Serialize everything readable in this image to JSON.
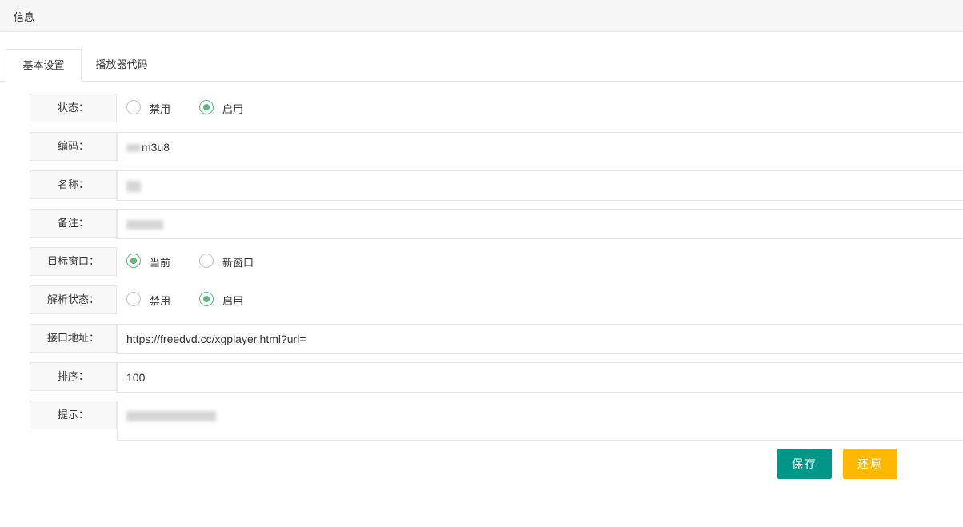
{
  "header": {
    "title": "信息"
  },
  "tabs": [
    {
      "label": "基本设置",
      "active": true
    },
    {
      "label": "播放器代码",
      "active": false
    }
  ],
  "form": {
    "status": {
      "label": "状态：",
      "options": [
        "禁用",
        "启用"
      ],
      "selected": "启用"
    },
    "code": {
      "label": "编码：",
      "value": "m3u8"
    },
    "name": {
      "label": "名称："
    },
    "remark": {
      "label": "备注："
    },
    "target": {
      "label": "目标窗口：",
      "options": [
        "当前",
        "新窗口"
      ],
      "selected": "当前"
    },
    "parse_status": {
      "label": "解析状态：",
      "options": [
        "禁用",
        "启用"
      ],
      "selected": "启用"
    },
    "api": {
      "label": "接口地址：",
      "value": "https://freedvd.cc/xgplayer.html?url="
    },
    "sort": {
      "label": "排序：",
      "value": "100"
    },
    "tip": {
      "label": "提示："
    }
  },
  "buttons": {
    "save": "保存",
    "reset": "还原"
  },
  "colors": {
    "primary": "#009688",
    "warm": "#ffb800",
    "radio_checked": "#5fb878"
  }
}
